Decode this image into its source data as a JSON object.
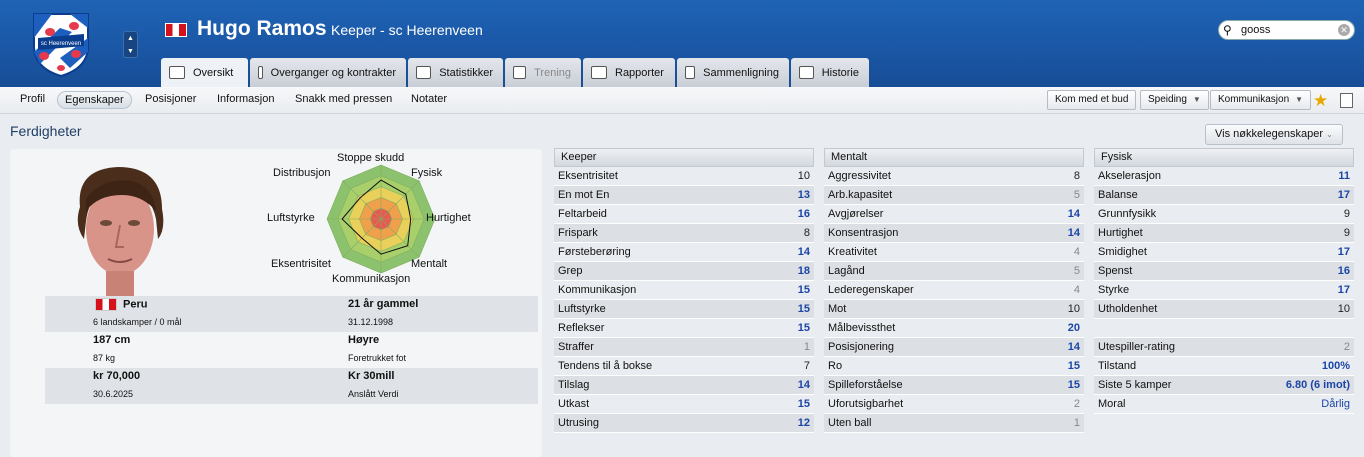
{
  "header": {
    "player_name": "Hugo Ramos",
    "subtitle": "Keeper - sc Heerenveen",
    "search_value": "gooss",
    "crest_text": "sc Heerenveen",
    "nation_flag": "peru-flag"
  },
  "tabs": [
    {
      "label": "Oversikt",
      "icon": "overview-icon",
      "active": true
    },
    {
      "label": "Overganger og kontrakter",
      "icon": "document-icon"
    },
    {
      "label": "Statistikker",
      "icon": "bar-chart-icon"
    },
    {
      "label": "Trening",
      "icon": "cloud-icon",
      "disabled": true
    },
    {
      "label": "Rapporter",
      "icon": "report-icon"
    },
    {
      "label": "Sammenligning",
      "icon": "compare-icon"
    },
    {
      "label": "Historie",
      "icon": "history-icon"
    }
  ],
  "subnav": {
    "items": [
      "Profil",
      "Egenskaper",
      "Posisjoner",
      "Informasjon",
      "Snakk med pressen",
      "Notater"
    ],
    "active": "Egenskaper",
    "btn_offer": "Kom med et bud",
    "btn_scout": "Speiding",
    "btn_comm": "Kommunikasjon"
  },
  "section": {
    "title": "Ferdigheter",
    "key_button": "Vis nøkkelegenskaper"
  },
  "radar": {
    "labels": [
      "Stoppe skudd",
      "Fysisk",
      "Hurtighet",
      "Mentalt",
      "Kommunikasjon",
      "Eksentrisitet",
      "Luftstyrke",
      "Distribusjon"
    ],
    "values": [
      0.72,
      0.65,
      0.55,
      0.7,
      0.65,
      0.5,
      0.72,
      0.55
    ]
  },
  "info": [
    {
      "a_main": "Peru",
      "a_sub": "6 landskamper / 0 mål",
      "b_main": "21 år gammel",
      "b_sub": "31.12.1998"
    },
    {
      "a_main": "187 cm",
      "a_sub": "87 kg",
      "b_main": "Høyre",
      "b_sub": "Foretrukket fot"
    },
    {
      "a_main": "kr 70,000",
      "a_sub": "30.6.2025",
      "b_main": "Kr 30mill",
      "b_sub": "Anslått Verdi"
    }
  ],
  "attributes": {
    "keeper": {
      "title": "Keeper",
      "rows": [
        [
          "Eksentrisitet",
          "10"
        ],
        [
          "En mot En",
          "13"
        ],
        [
          "Feltarbeid",
          "16"
        ],
        [
          "Frispark",
          "8"
        ],
        [
          "Førsteberøring",
          "14"
        ],
        [
          "Grep",
          "18"
        ],
        [
          "Kommunikasjon",
          "15"
        ],
        [
          "Luftstyrke",
          "15"
        ],
        [
          "Reflekser",
          "15"
        ],
        [
          "Straffer",
          "1"
        ],
        [
          "Tendens til å bokse",
          "7"
        ],
        [
          "Tilslag",
          "14"
        ],
        [
          "Utkast",
          "15"
        ],
        [
          "Utrusing",
          "12"
        ]
      ]
    },
    "mental": {
      "title": "Mentalt",
      "rows": [
        [
          "Aggressivitet",
          "8"
        ],
        [
          "Arb.kapasitet",
          "5"
        ],
        [
          "Avgjørelser",
          "14"
        ],
        [
          "Konsentrasjon",
          "14"
        ],
        [
          "Kreativitet",
          "4"
        ],
        [
          "Lagånd",
          "5"
        ],
        [
          "Lederegenskaper",
          "4"
        ],
        [
          "Mot",
          "10"
        ],
        [
          "Målbevissthet",
          "20"
        ],
        [
          "Posisjonering",
          "14"
        ],
        [
          "Ro",
          "15"
        ],
        [
          "Spilleforståelse",
          "15"
        ],
        [
          "Uforutsigbarhet",
          "2"
        ],
        [
          "Uten ball",
          "1"
        ]
      ]
    },
    "physical": {
      "title": "Fysisk",
      "rows": [
        [
          "Akselerasjon",
          "11"
        ],
        [
          "Balanse",
          "17"
        ],
        [
          "Grunnfysikk",
          "9"
        ],
        [
          "Hurtighet",
          "9"
        ],
        [
          "Smidighet",
          "17"
        ],
        [
          "Spenst",
          "16"
        ],
        [
          "Styrke",
          "17"
        ],
        [
          "Utholdenhet",
          "10"
        ]
      ],
      "extra": [
        [
          "",
          ""
        ],
        [
          "Utespiller-rating",
          "2"
        ],
        [
          "Tilstand",
          "100%"
        ],
        [
          "Siste 5 kamper",
          "6.80 (6 imot)"
        ],
        [
          "Moral",
          "Dårlig"
        ]
      ]
    }
  }
}
